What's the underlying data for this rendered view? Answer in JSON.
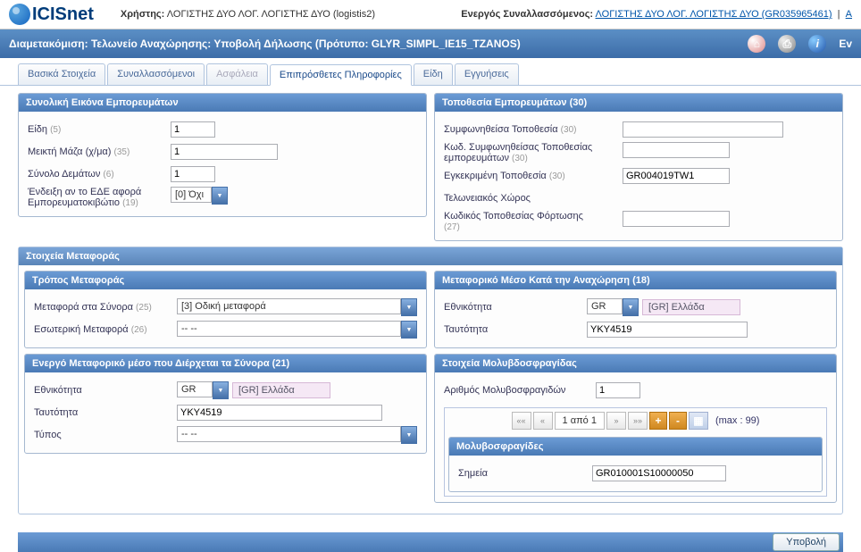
{
  "header": {
    "logo_text": "ICISnet",
    "user_label": "Χρήστης:",
    "user_value": "ΛΟΓΙΣΤΗΣ ΔΥΟ ΛΟΓ. ΛΟΓΙΣΤΗΣ ΔΥΟ (logistis2)",
    "active_label": "Ενεργός Συναλλασσόμενος:",
    "active_value": "ΛΟΓΙΣΤΗΣ ΔΥΟ ΛΟΓ. ΛΟΓΙΣΤΗΣ ΔΥΟ (GR035965461)",
    "link_a": "A"
  },
  "toolbar": {
    "title": "Διαμετακόμιση: Τελωνείο Αναχώρησης: Υποβολή Δήλωσης    (Πρότυπο: GLYR_SIMPL_IE15_TZANOS)",
    "ev": "Ev"
  },
  "tabs": {
    "t1": "Βασικά Στοιχεία",
    "t2": "Συναλλασσόμενοι",
    "t3": "Ασφάλεια",
    "t4": "Επιπρόσθετες Πληροφορίες",
    "t5": "Είδη",
    "t6": "Εγγυήσεις"
  },
  "goods": {
    "title": "Συνολική Εικόνα Εμπορευμάτων",
    "items_label": "Είδη",
    "items_hint": "(5)",
    "items_value": "1",
    "mass_label": "Μεικτή Μάζα (χ/μα)",
    "mass_hint": "(35)",
    "mass_value": "1",
    "packages_label": "Σύνολο Δεμάτων",
    "packages_hint": "(6)",
    "packages_value": "1",
    "container_label1": "Ένδειξη αν το ΕΔΕ αφορά",
    "container_label2": "Εμπορευματοκιβώτιο",
    "container_hint": "(19)",
    "container_value": "[0] Όχι"
  },
  "location": {
    "title": "Τοποθεσία Εμπορευμάτων (30)",
    "agreed_label": "Συμφωνηθείσα Τοποθεσία",
    "agreed_hint": "(30)",
    "agreed_value": "",
    "code_label1": "Κωδ. Συμφωνηθείσας Τοποθεσίας",
    "code_label2": "εμπορευμάτων",
    "code_hint": "(30)",
    "code_value": "",
    "approved_label": "Εγκεκριμένη Τοποθεσία",
    "approved_hint": "(30)",
    "approved_value": "GR004019TW1",
    "customs_label": "Τελωνειακός Χώρος",
    "loading_label1": "Κωδικός Τοποθεσίας Φόρτωσης",
    "loading_hint": "(27)",
    "loading_value": ""
  },
  "transport": {
    "title": "Στοιχεία Μεταφοράς",
    "mode": {
      "title": "Τρόπος Μεταφοράς",
      "border_label": "Μεταφορά στα Σύνορα",
      "border_hint": "(25)",
      "border_value": "[3] Οδική μεταφορά",
      "inland_label": "Εσωτερική Μεταφορά",
      "inland_hint": "(26)",
      "inland_value": "-- --"
    },
    "departure": {
      "title": "Μεταφορικό Μέσο Κατά την Αναχώρηση (18)",
      "nat_label": "Εθνικότητα",
      "nat_value": "GR",
      "nat_display": "[GR] Ελλάδα",
      "id_label": "Ταυτότητα",
      "id_value": "YKY4519"
    },
    "active": {
      "title": "Ενεργό Μεταφορικό μέσο που Διέρχεται τα Σύνορα (21)",
      "nat_label": "Εθνικότητα",
      "nat_value": "GR",
      "nat_display": "[GR] Ελλάδα",
      "id_label": "Ταυτότητα",
      "id_value": "YKY4519",
      "type_label": "Τύπος",
      "type_value": "-- --"
    },
    "seals": {
      "title": "Στοιχεία Μολυβδοσφραγίδας",
      "count_label": "Αριθμός Μολυβοσφραγιδών",
      "count_value": "1",
      "pager_info": "1 από 1",
      "pager_max": "(max : 99)",
      "sub_title": "Μολυβοσφραγίδες",
      "mark_label": "Σημεία",
      "mark_value": "GR010001S10000050"
    }
  },
  "footer": {
    "submit": "Υποβολή"
  }
}
